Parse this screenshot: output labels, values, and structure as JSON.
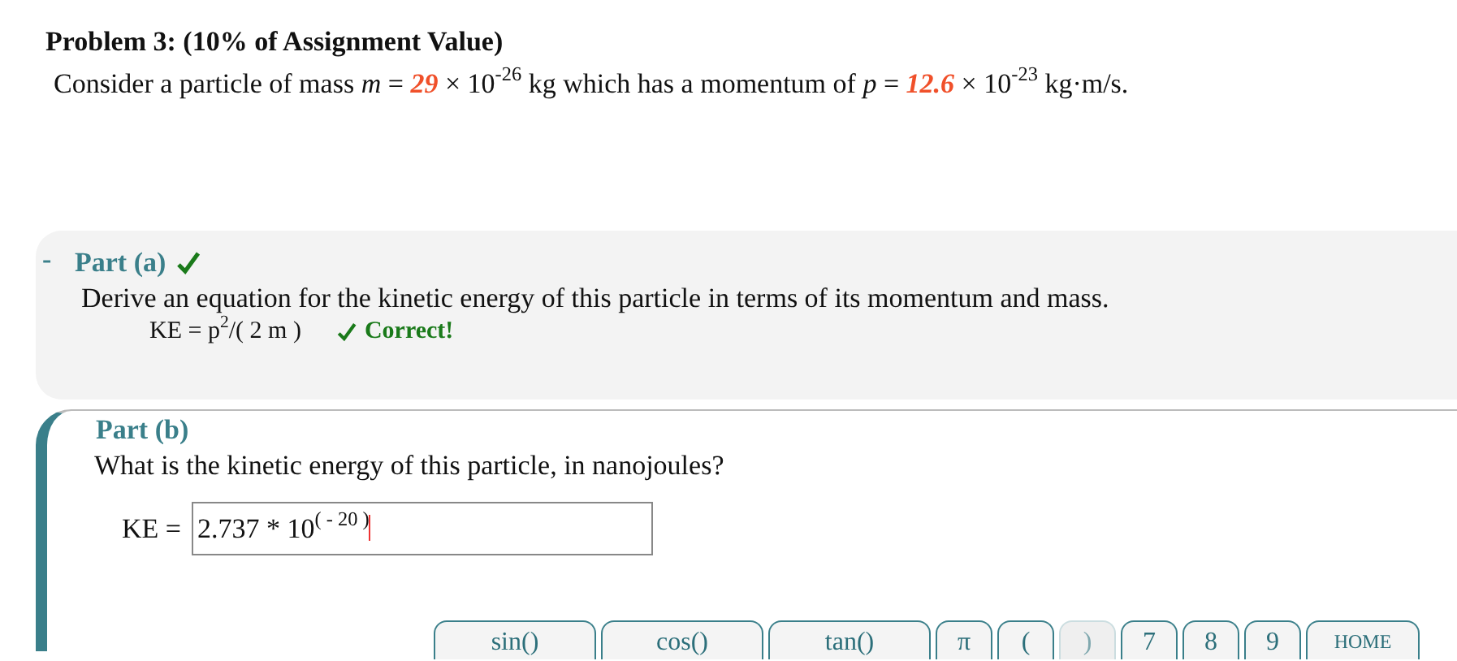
{
  "problem": {
    "title": "Problem 3: (10% of Assignment Value)",
    "statement": [
      {
        "kind": "text",
        "text": "Consider a particle of mass "
      },
      {
        "kind": "var",
        "text": "m"
      },
      {
        "kind": "text",
        "text": " = "
      },
      {
        "kind": "value",
        "text": "29"
      },
      {
        "kind": "text",
        "text": " × 10$^{-26}$ kg which has a momentum of "
      },
      {
        "kind": "var",
        "text": "p"
      },
      {
        "kind": "text",
        "text": " = "
      },
      {
        "kind": "value",
        "text": "12.6"
      },
      {
        "kind": "text",
        "text": " × 10$^{-23}$ kg·m/s."
      }
    ]
  },
  "parts": [
    {
      "toggle": "-",
      "title": "Part (a)",
      "correct": true,
      "question": "Derive an equation for the kinetic energy of this particle in terms of its momentum and mass.",
      "answer": "KE = p$^{2}$/( 2 m )",
      "feedback": "Correct!"
    },
    {
      "title": "Part (b)",
      "correct": false,
      "question": "What is the kinetic energy of this particle, in nanojoules?",
      "field_label": "KE =",
      "field_value": "2.737 * 10$^{( - 20 )}$"
    }
  ],
  "keypad": [
    {
      "label": "sin()",
      "kind": "wide",
      "disabled": false
    },
    {
      "label": "cos()",
      "kind": "wide",
      "disabled": false
    },
    {
      "label": "tan()",
      "kind": "wide",
      "disabled": false
    },
    {
      "label": "π",
      "kind": "narrow",
      "disabled": false
    },
    {
      "label": "(",
      "kind": "narrow",
      "disabled": false
    },
    {
      "label": ")",
      "kind": "narrow",
      "disabled": true
    },
    {
      "label": "7",
      "kind": "narrow",
      "disabled": false
    },
    {
      "label": "8",
      "kind": "narrow",
      "disabled": false
    },
    {
      "label": "9",
      "kind": "narrow",
      "disabled": false
    },
    {
      "label": "HOME",
      "kind": "small",
      "disabled": false
    }
  ]
}
